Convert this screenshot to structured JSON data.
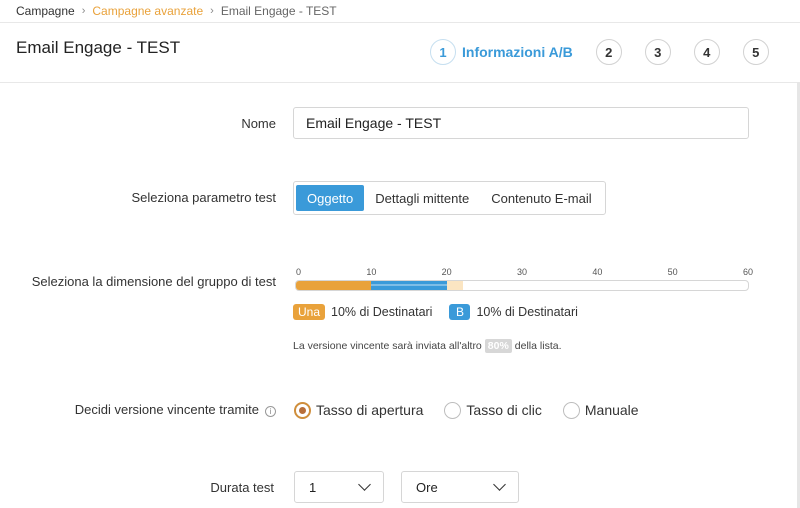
{
  "breadcrumb": [
    {
      "label": "Campagne"
    },
    {
      "label": "Campagne avanzate"
    },
    {
      "label": "Email Engage - TEST"
    }
  ],
  "header": {
    "title": "Email Engage - TEST",
    "steps": [
      {
        "number": "1",
        "label": "Informazioni A/B",
        "active": true
      },
      {
        "number": "2"
      },
      {
        "number": "3"
      },
      {
        "number": "4"
      },
      {
        "number": "5"
      }
    ]
  },
  "form": {
    "name": {
      "label": "Nome",
      "value": "Email Engage - TEST"
    },
    "test_param": {
      "label": "Seleziona parametro test",
      "options": [
        "Oggetto",
        "Dettagli mittente",
        "Contenuto E-mail"
      ],
      "selected": "Oggetto"
    },
    "group_size": {
      "label": "Seleziona la dimensione del gruppo di test",
      "ticks": [
        "0",
        "10",
        "20",
        "30",
        "40",
        "50",
        "60"
      ],
      "max": 60,
      "a_percent": 10,
      "b_percent": 10,
      "a_badge": "Una",
      "a_text": "10% di Destinatari",
      "b_badge": "B",
      "b_text": "10% di Destinatari",
      "note_before": "La versione vincente sarà inviata all'altro",
      "note_pct": "80%",
      "note_after": "della lista."
    },
    "winner": {
      "label": "Decidi versione vincente tramite",
      "info_icon": "i",
      "options": [
        "Tasso di apertura",
        "Tasso di clic",
        "Manuale"
      ],
      "selected": "Tasso di apertura"
    },
    "duration": {
      "label": "Durata test",
      "value": "1",
      "unit": "Ore"
    }
  },
  "colors": {
    "accent_orange": "#e9a23b",
    "accent_blue": "#3a9ad9"
  }
}
